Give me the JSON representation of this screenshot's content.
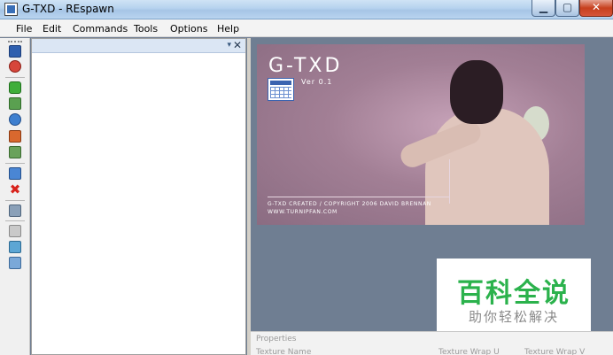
{
  "window": {
    "title": "G-TXD - REspawn"
  },
  "menu": {
    "items": [
      "File",
      "Edit",
      "Commands",
      "Tools",
      "Options",
      "Help"
    ]
  },
  "toolbar": {
    "icons": [
      "save-icon",
      "export-icon",
      "add-icon",
      "import-icon",
      "replace-icon",
      "paint-icon",
      "resize-icon",
      "rename-icon",
      "delete-icon",
      "properties-icon",
      "grid-view-icon",
      "texture-view-icon",
      "preview-icon"
    ]
  },
  "left_panel": {
    "dropdown_glyph": "▾",
    "close_glyph": "✕"
  },
  "splash": {
    "title": "G-TXD",
    "version": "Ver 0.1",
    "copyright": "G-TXD CREATED / COPYRIGHT 2006 DAVID BRENNAN",
    "website": "WWW.TURNIPFAN.COM"
  },
  "watermark": {
    "main": "百科全说",
    "sub": "助你轻松解决"
  },
  "properties": {
    "title": "Properties",
    "columns": [
      "Texture Name",
      "Texture Wrap U",
      "Texture Wrap V"
    ]
  },
  "colors": {
    "accent": "#3b64b0",
    "watermark_green": "#2bb24c",
    "background": "#6f7e92"
  }
}
